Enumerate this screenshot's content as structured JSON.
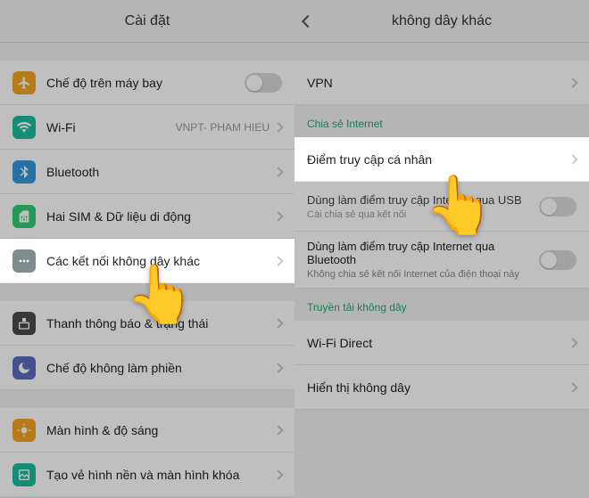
{
  "left": {
    "title": "Cài đặt",
    "items": {
      "airplane": "Chế độ trên máy bay",
      "wifi": "Wi-Fi",
      "wifi_value": "VNPT- PHAM HIEU",
      "bluetooth": "Bluetooth",
      "sim": "Hai SIM & Dữ liệu di động",
      "more": "Các kết nối không dây khác",
      "status": "Thanh thông báo & trạng thái",
      "dnd": "Chế độ không làm phiền",
      "display": "Màn hình & độ sáng",
      "wallpaper": "Tạo vẻ hình nền và màn hình khóa"
    }
  },
  "right": {
    "title": "không dây khác",
    "vpn": "VPN",
    "section_share": "Chia sẻ Internet",
    "hotspot": "Điểm truy cập cá nhân",
    "usb_tether": "Dùng làm điểm truy cập Internet qua USB",
    "usb_tether_sub": "Cài chia sẻ qua kết nối",
    "bt_tether": "Dùng làm điểm truy cập Internet qua Bluetooth",
    "bt_tether_sub": "Không chia sẻ kết nối Internet của điện thoại này",
    "section_wireless": "Truyền tải không dây",
    "wifi_direct": "Wi-Fi Direct",
    "wireless_display": "Hiển thị không dây"
  },
  "pointer": "👆"
}
